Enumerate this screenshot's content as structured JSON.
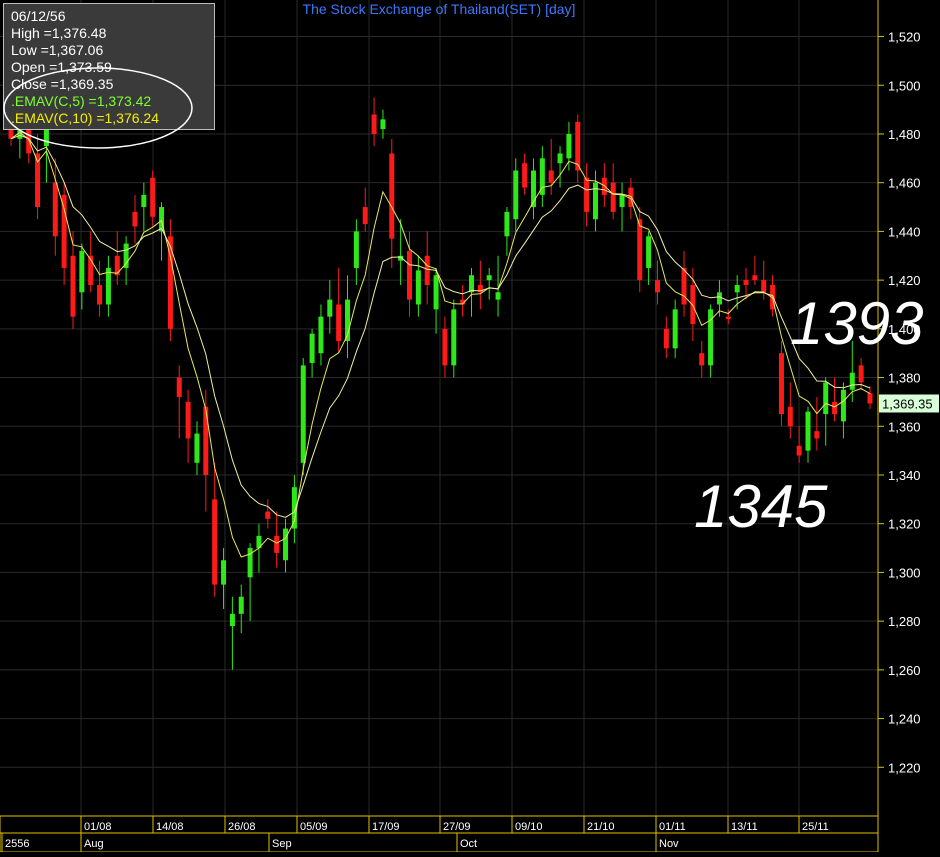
{
  "title": "The Stock Exchange of Thailand(SET) [day]",
  "info_panel": {
    "date": "06/12/56",
    "high": "High  =1,376.48",
    "low": "Low  =1,367.06",
    "open": "Open  =1,373.59",
    "close": "Close  =1,369.35",
    "emav5": ".EMAV(C,5)    =1,373.42",
    "emav10": ".EMAV(C,10)   =1,376.24"
  },
  "last_price_label": "1,369.35",
  "annotations": {
    "upper": "1393",
    "lower": "1345"
  },
  "x_axis": {
    "dates": [
      "01/08",
      "14/08",
      "26/08",
      "05/09",
      "17/09",
      "27/09",
      "09/10",
      "21/10",
      "01/11",
      "13/11",
      "25/11"
    ],
    "months": [
      "2556",
      "Aug",
      "Sep",
      "Oct",
      "Nov"
    ]
  },
  "colors": {
    "up": "#2ee81a",
    "down": "#ff1a1a",
    "ema5": "#e8e85a",
    "ema10": "#f0f0a0",
    "grid": "#2a2a2a",
    "axis": "#e0c000",
    "title": "#3c78ff"
  },
  "chart_data": {
    "type": "candlestick",
    "title": "The Stock Exchange of Thailand(SET) [day]",
    "ylim": [
      1200,
      1535
    ],
    "yticks": [
      1220,
      1240,
      1260,
      1280,
      1300,
      1320,
      1340,
      1360,
      1380,
      1400,
      1420,
      1440,
      1460,
      1480,
      1500,
      1520
    ],
    "ytick_labels": [
      "1,220",
      "1,240",
      "1,260",
      "1,280",
      "1,300",
      "1,320",
      "1,340",
      "1,360",
      "1,380",
      "1,400",
      "1,420",
      "1,440",
      "1,460",
      "1,480",
      "1,500",
      "1,520"
    ],
    "candles": [
      [
        1490,
        1495,
        1475,
        1478
      ],
      [
        1478,
        1490,
        1470,
        1486
      ],
      [
        1486,
        1492,
        1468,
        1472
      ],
      [
        1472,
        1480,
        1445,
        1450
      ],
      [
        1475,
        1485,
        1460,
        1482
      ],
      [
        1460,
        1470,
        1430,
        1438
      ],
      [
        1455,
        1460,
        1418,
        1425
      ],
      [
        1430,
        1440,
        1400,
        1405
      ],
      [
        1415,
        1435,
        1408,
        1432
      ],
      [
        1430,
        1440,
        1415,
        1418
      ],
      [
        1418,
        1428,
        1405,
        1410
      ],
      [
        1410,
        1430,
        1405,
        1425
      ],
      [
        1430,
        1440,
        1418,
        1422
      ],
      [
        1425,
        1438,
        1418,
        1435
      ],
      [
        1448,
        1455,
        1435,
        1442
      ],
      [
        1450,
        1460,
        1440,
        1455
      ],
      [
        1462,
        1465,
        1442,
        1446
      ],
      [
        1440,
        1452,
        1428,
        1450
      ],
      [
        1438,
        1445,
        1395,
        1400
      ],
      [
        1380,
        1385,
        1355,
        1372
      ],
      [
        1370,
        1375,
        1345,
        1355
      ],
      [
        1345,
        1362,
        1340,
        1357
      ],
      [
        1368,
        1375,
        1325,
        1340
      ],
      [
        1330,
        1345,
        1290,
        1295
      ],
      [
        1295,
        1310,
        1285,
        1305
      ],
      [
        1278,
        1290,
        1260,
        1283
      ],
      [
        1283,
        1295,
        1275,
        1290
      ],
      [
        1298,
        1312,
        1280,
        1310
      ],
      [
        1310,
        1320,
        1300,
        1315
      ],
      [
        1325,
        1330,
        1318,
        1322
      ],
      [
        1315,
        1325,
        1302,
        1308
      ],
      [
        1305,
        1322,
        1300,
        1318
      ],
      [
        1318,
        1340,
        1312,
        1335
      ],
      [
        1345,
        1388,
        1340,
        1385
      ],
      [
        1386,
        1400,
        1380,
        1398
      ],
      [
        1390,
        1410,
        1385,
        1405
      ],
      [
        1405,
        1420,
        1398,
        1412
      ],
      [
        1410,
        1425,
        1390,
        1395
      ],
      [
        1395,
        1422,
        1388,
        1412
      ],
      [
        1425,
        1445,
        1418,
        1440
      ],
      [
        1450,
        1458,
        1440,
        1443
      ],
      [
        1488,
        1495,
        1475,
        1480
      ],
      [
        1482,
        1490,
        1478,
        1486
      ],
      [
        1472,
        1478,
        1425,
        1437
      ],
      [
        1428,
        1445,
        1418,
        1430
      ],
      [
        1432,
        1440,
        1405,
        1412
      ],
      [
        1410,
        1430,
        1405,
        1424
      ],
      [
        1430,
        1440,
        1410,
        1418
      ],
      [
        1408,
        1425,
        1398,
        1422
      ],
      [
        1400,
        1405,
        1380,
        1385
      ],
      [
        1385,
        1412,
        1380,
        1408
      ],
      [
        1412,
        1418,
        1405,
        1410
      ],
      [
        1415,
        1425,
        1405,
        1422
      ],
      [
        1418,
        1428,
        1408,
        1415
      ],
      [
        1420,
        1425,
        1412,
        1422
      ],
      [
        1412,
        1430,
        1405,
        1415
      ],
      [
        1438,
        1450,
        1430,
        1448
      ],
      [
        1445,
        1470,
        1440,
        1465
      ],
      [
        1468,
        1472,
        1455,
        1458
      ],
      [
        1450,
        1470,
        1445,
        1465
      ],
      [
        1455,
        1475,
        1450,
        1470
      ],
      [
        1465,
        1478,
        1455,
        1460
      ],
      [
        1468,
        1475,
        1458,
        1472
      ],
      [
        1470,
        1485,
        1465,
        1480
      ],
      [
        1485,
        1488,
        1460,
        1465
      ],
      [
        1462,
        1468,
        1442,
        1448
      ],
      [
        1445,
        1465,
        1440,
        1460
      ],
      [
        1462,
        1468,
        1450,
        1455
      ],
      [
        1460,
        1468,
        1445,
        1448
      ],
      [
        1450,
        1460,
        1440,
        1455
      ],
      [
        1458,
        1462,
        1445,
        1450
      ],
      [
        1445,
        1450,
        1415,
        1420
      ],
      [
        1425,
        1440,
        1418,
        1438
      ],
      [
        1420,
        1428,
        1410,
        1415
      ],
      [
        1400,
        1405,
        1388,
        1392
      ],
      [
        1392,
        1412,
        1388,
        1408
      ],
      [
        1425,
        1432,
        1405,
        1410
      ],
      [
        1418,
        1425,
        1395,
        1402
      ],
      [
        1390,
        1395,
        1380,
        1385
      ],
      [
        1385,
        1410,
        1380,
        1408
      ],
      [
        1410,
        1420,
        1405,
        1415
      ],
      [
        1405,
        1408,
        1402,
        1404
      ],
      [
        1415,
        1422,
        1408,
        1418
      ],
      [
        1420,
        1425,
        1412,
        1418
      ],
      [
        1422,
        1430,
        1418,
        1420
      ],
      [
        1420,
        1428,
        1412,
        1415
      ],
      [
        1418,
        1422,
        1405,
        1408
      ],
      [
        1390,
        1395,
        1360,
        1365
      ],
      [
        1368,
        1378,
        1355,
        1360
      ],
      [
        1352,
        1360,
        1345,
        1348
      ],
      [
        1350,
        1368,
        1345,
        1366
      ],
      [
        1358,
        1372,
        1350,
        1355
      ],
      [
        1365,
        1380,
        1352,
        1378
      ],
      [
        1370,
        1380,
        1362,
        1365
      ],
      [
        1362,
        1378,
        1355,
        1375
      ],
      [
        1375,
        1395,
        1370,
        1382
      ],
      [
        1385,
        1388,
        1375,
        1378
      ],
      [
        1373.59,
        1376.48,
        1367.06,
        1369.35
      ]
    ]
  }
}
